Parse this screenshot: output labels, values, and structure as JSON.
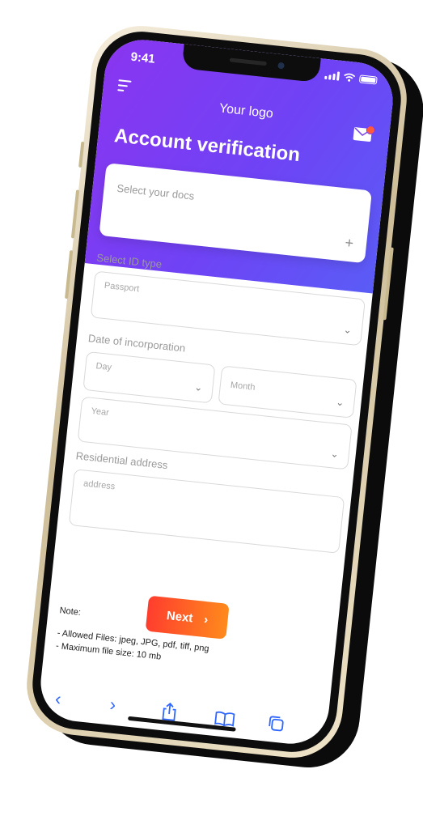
{
  "status_bar": {
    "time": "9:41"
  },
  "header": {
    "logo": "Your logo",
    "title": "Account verification"
  },
  "docs": {
    "placeholder": "Select your docs",
    "add_icon": "+"
  },
  "id_type": {
    "label": "Select ID type",
    "placeholder": "Passport"
  },
  "incorporation": {
    "label": "Date of incorporation",
    "day": "Day",
    "month": "Month",
    "year": "Year"
  },
  "address": {
    "label": "Residential address",
    "placeholder": "address"
  },
  "next_button": {
    "label": "Next",
    "arrow": "›"
  },
  "note": {
    "title": "Note:",
    "allowed_files": "- Allowed Files: jpeg, JPG, pdf, tiff, png",
    "max_size": "- Maximum file size: 10 mb"
  },
  "toolbar": {
    "back": "‹",
    "forward": "›"
  },
  "colors": {
    "accent_start": "#8a35f0",
    "accent_end": "#5a5cf6",
    "button_start": "#ff3d2e",
    "button_end": "#ff8a1c",
    "toolbar_icons": "#2f66ff"
  }
}
